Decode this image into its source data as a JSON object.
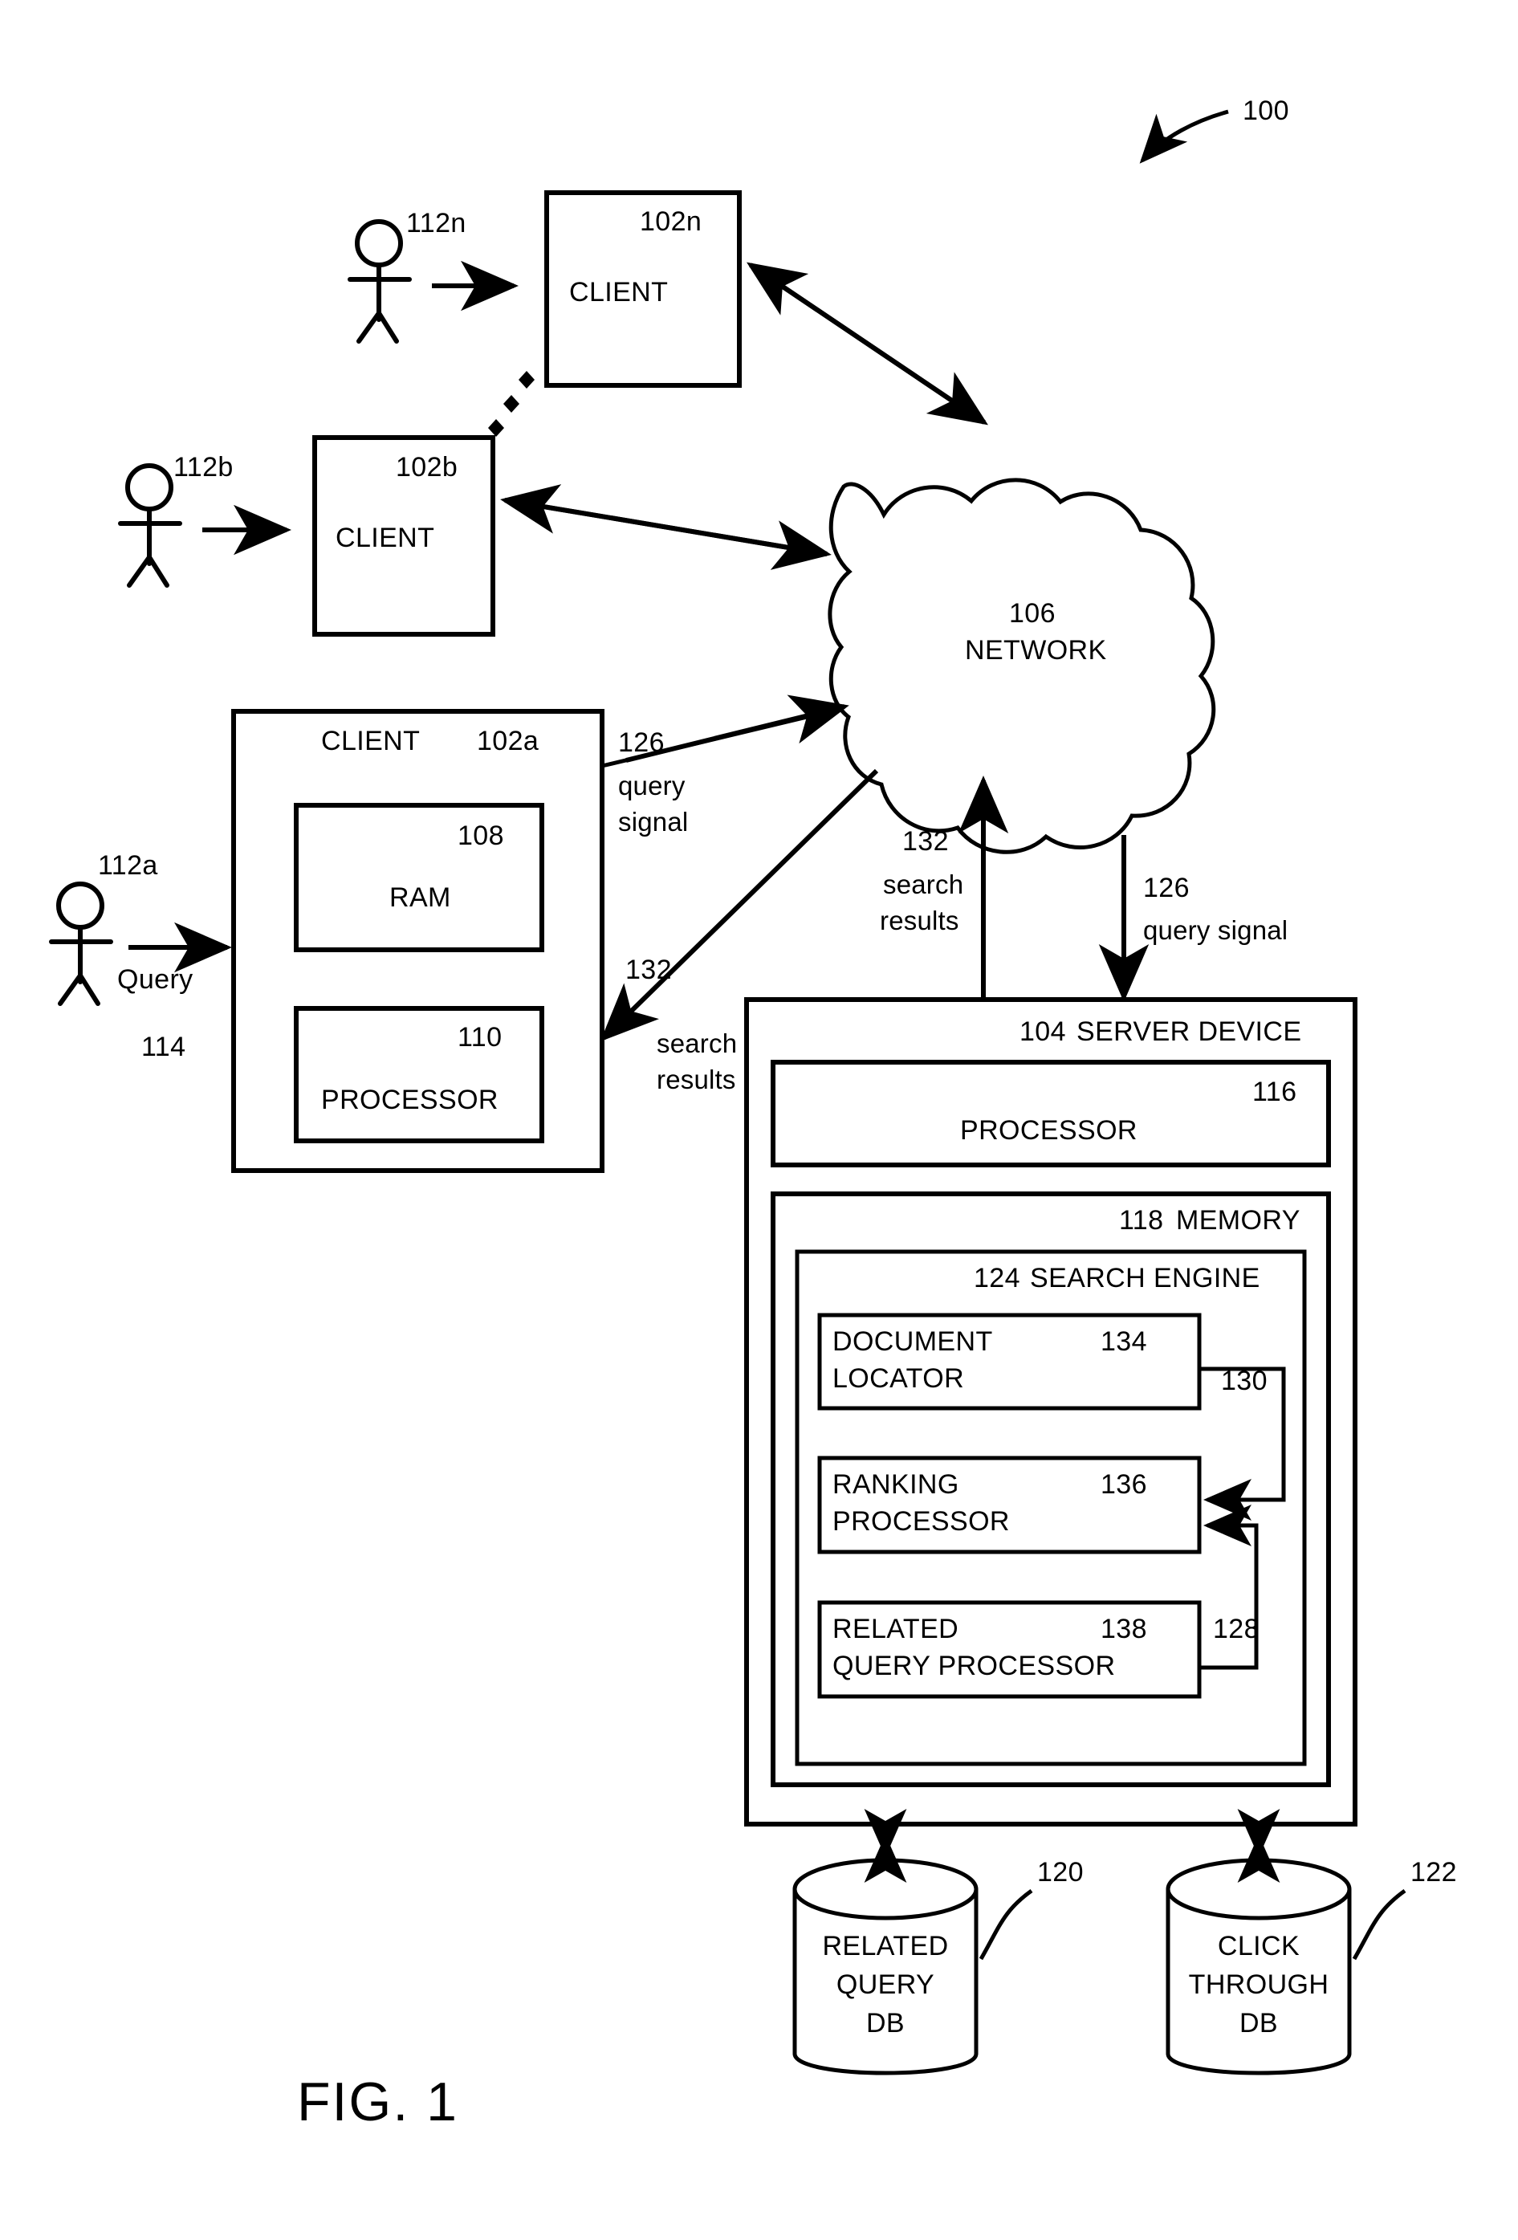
{
  "figure": {
    "caption": "FIG. 1",
    "system_ref": "100"
  },
  "users": [
    {
      "ref": "112n",
      "name": "user-112n"
    },
    {
      "ref": "112b",
      "name": "user-112b"
    },
    {
      "ref": "112a",
      "name": "user-112a"
    }
  ],
  "query_input": {
    "label": "Query",
    "ref": "114"
  },
  "clients": [
    {
      "title": "CLIENT",
      "ref": "102n"
    },
    {
      "title": "CLIENT",
      "ref": "102b"
    },
    {
      "title": "CLIENT",
      "ref": "102a"
    }
  ],
  "client_a_components": [
    {
      "title": "RAM",
      "ref": "108"
    },
    {
      "title": "PROCESSOR",
      "ref": "110"
    }
  ],
  "network": {
    "ref": "106",
    "title": "NETWORK"
  },
  "signals": {
    "query_signal_to_network": {
      "ref": "126",
      "line1": "query",
      "line2": "signal"
    },
    "search_results_to_client": {
      "ref": "132",
      "line1": "search",
      "line2": "results"
    },
    "search_results_to_network": {
      "ref": "132",
      "line1": "search",
      "line2": "results"
    },
    "query_signal_to_server": {
      "ref": "126",
      "label": "query signal"
    }
  },
  "server": {
    "ref": "104",
    "title": "SERVER DEVICE",
    "processor": {
      "ref": "116",
      "title": "PROCESSOR"
    },
    "memory": {
      "ref": "118",
      "title": "MEMORY"
    },
    "search_engine": {
      "ref": "124",
      "title": "SEARCH ENGINE",
      "modules": [
        {
          "ref": "134",
          "line1": "DOCUMENT",
          "line2": "LOCATOR"
        },
        {
          "ref": "136",
          "line1": "RANKING",
          "line2": "PROCESSOR"
        },
        {
          "ref": "138",
          "line1": "RELATED",
          "line2": "QUERY PROCESSOR"
        }
      ],
      "feedback_links": [
        {
          "ref": "130"
        },
        {
          "ref": "128"
        }
      ]
    }
  },
  "databases": [
    {
      "ref": "120",
      "line1": "RELATED",
      "line2": "QUERY",
      "line3": "DB"
    },
    {
      "ref": "122",
      "line1": "CLICK",
      "line2": "THROUGH",
      "line3": "DB"
    }
  ],
  "colors": {
    "ink": "#000000",
    "paper": "#ffffff"
  }
}
